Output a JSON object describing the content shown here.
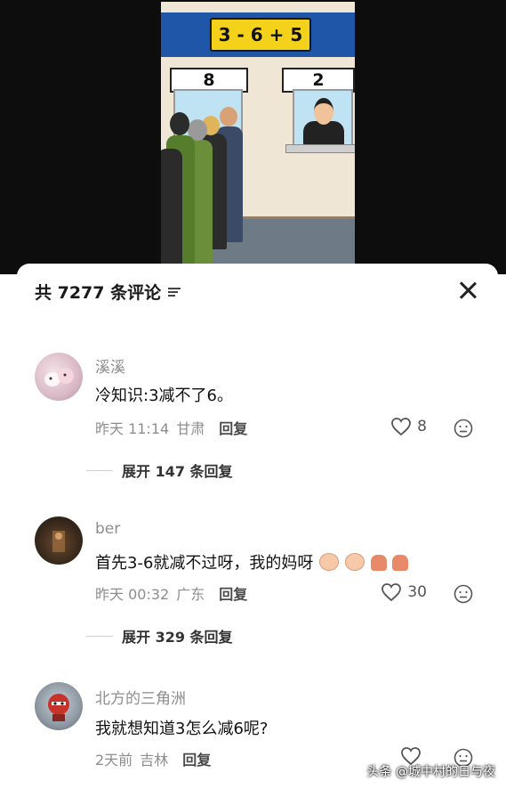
{
  "video": {
    "sign_equation": "3 - 6 + 5",
    "counter_left": "8",
    "counter_right": "2"
  },
  "panel": {
    "title": "共 7277 条评论",
    "filter_icon": "filter-lines-icon",
    "close_icon": "close-icon"
  },
  "comments": [
    {
      "username": "溪溪",
      "text": "冷知识:3减不了6。",
      "time": "昨天 11:14",
      "location": "甘肃",
      "reply_label": "回复",
      "likes": "8",
      "expand_label": "展开 147 条回复"
    },
    {
      "username": "ber",
      "text": "首先3-6就减不过呀，我的妈呀",
      "emojis": [
        "crying-face-emoji",
        "crying-face-emoji",
        "praying-hands-emoji",
        "praying-hands-emoji"
      ],
      "time": "昨天 00:32",
      "location": "广东",
      "reply_label": "回复",
      "likes": "30",
      "expand_label": "展开 329 条回复"
    },
    {
      "username": "北方的三角洲",
      "text": "我就想知道3怎么减6呢?",
      "time": "2天前",
      "location": "吉林",
      "reply_label": "回复",
      "likes": ""
    }
  ],
  "watermark": "头条 @城中村的日与夜",
  "colors": {
    "sign_board": "#1f56a8",
    "sign_box": "#f4d21b",
    "text_primary": "#111111",
    "text_secondary": "#8d8d8d"
  }
}
